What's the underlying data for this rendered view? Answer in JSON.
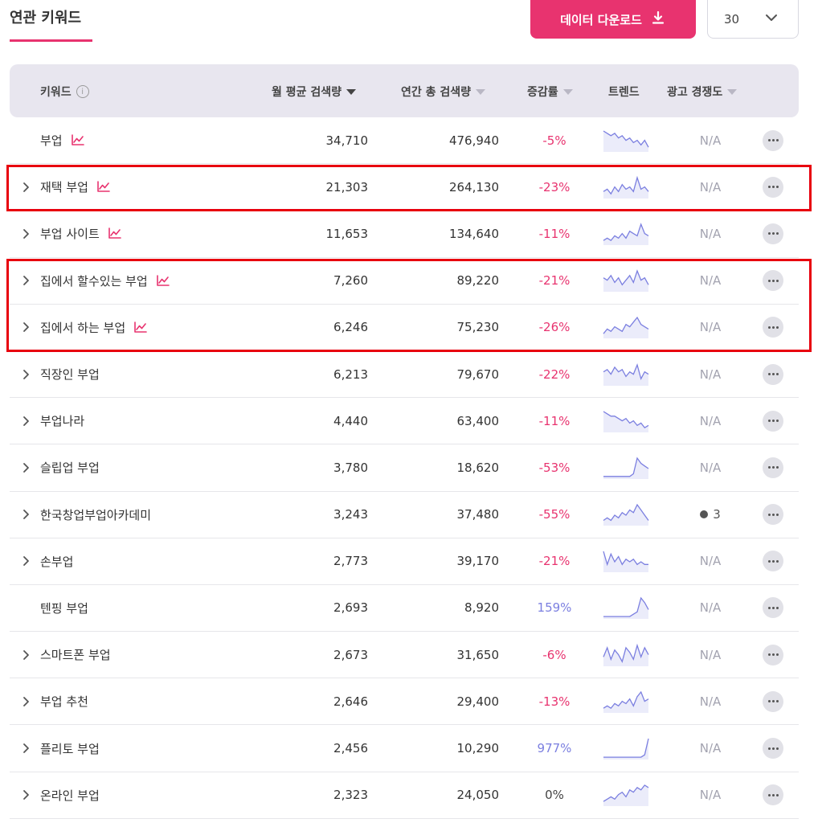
{
  "header": {
    "title": "연관 키워드",
    "download_label": "데이터 다운로드",
    "page_size": "30"
  },
  "columns": {
    "keyword": "키워드",
    "monthly": "월 평균 검색량",
    "yearly": "연간 총 검색량",
    "change": "증감률",
    "trend": "트렌드",
    "competition": "광고 경쟁도"
  },
  "colors": {
    "accent": "#e8336f",
    "negative": "#e8336f",
    "positive": "#7b7fe0",
    "neutral": "#444444",
    "highlight": "#e8000e",
    "sparkline": "#7b7fe0"
  },
  "rows": [
    {
      "keyword": "부업",
      "expandable": false,
      "trend_icon": true,
      "monthly": "34,710",
      "yearly": "476,940",
      "change": "-5%",
      "change_sign": "negative",
      "competition": "N/A",
      "spark": [
        9,
        8,
        7,
        8,
        6,
        7,
        5,
        6,
        4,
        5,
        3,
        5,
        2
      ]
    },
    {
      "keyword": "재택 부업",
      "expandable": true,
      "trend_icon": true,
      "monthly": "21,303",
      "yearly": "264,130",
      "change": "-23%",
      "change_sign": "negative",
      "competition": "N/A",
      "spark": [
        3,
        4,
        2,
        5,
        3,
        6,
        4,
        5,
        3,
        9,
        4,
        5,
        3
      ]
    },
    {
      "keyword": "부업 사이트",
      "expandable": true,
      "trend_icon": true,
      "monthly": "11,653",
      "yearly": "134,640",
      "change": "-11%",
      "change_sign": "negative",
      "competition": "N/A",
      "spark": [
        2,
        3,
        2,
        4,
        3,
        5,
        3,
        6,
        5,
        4,
        9,
        5,
        4
      ]
    },
    {
      "keyword": "집에서 할수있는 부업",
      "expandable": true,
      "trend_icon": true,
      "monthly": "7,260",
      "yearly": "89,220",
      "change": "-21%",
      "change_sign": "negative",
      "competition": "N/A",
      "spark": [
        6,
        5,
        7,
        4,
        6,
        3,
        5,
        7,
        4,
        9,
        5,
        6,
        3
      ]
    },
    {
      "keyword": "집에서 하는 부업",
      "expandable": true,
      "trend_icon": true,
      "monthly": "6,246",
      "yearly": "75,230",
      "change": "-26%",
      "change_sign": "negative",
      "competition": "N/A",
      "spark": [
        2,
        4,
        3,
        5,
        4,
        3,
        6,
        5,
        7,
        9,
        6,
        5,
        4
      ]
    },
    {
      "keyword": "직장인 부업",
      "expandable": true,
      "trend_icon": false,
      "monthly": "6,213",
      "yearly": "79,670",
      "change": "-22%",
      "change_sign": "negative",
      "competition": "N/A",
      "spark": [
        6,
        7,
        5,
        8,
        6,
        7,
        4,
        6,
        5,
        9,
        3,
        6,
        5
      ]
    },
    {
      "keyword": "부업나라",
      "expandable": true,
      "trend_icon": false,
      "monthly": "4,440",
      "yearly": "63,400",
      "change": "-11%",
      "change_sign": "negative",
      "competition": "N/A",
      "spark": [
        9,
        8,
        7,
        7,
        6,
        5,
        6,
        4,
        5,
        3,
        4,
        2,
        3
      ]
    },
    {
      "keyword": "슬립업 부업",
      "expandable": true,
      "trend_icon": false,
      "monthly": "3,780",
      "yearly": "18,620",
      "change": "-53%",
      "change_sign": "negative",
      "competition": "N/A",
      "spark": [
        1,
        1,
        1,
        1,
        1,
        1,
        1,
        1,
        2,
        8,
        6,
        5,
        4
      ]
    },
    {
      "keyword": "한국창업부업아카데미",
      "expandable": true,
      "trend_icon": false,
      "monthly": "3,243",
      "yearly": "37,480",
      "change": "-55%",
      "change_sign": "negative",
      "competition": "3",
      "competition_dot": true,
      "spark": [
        2,
        3,
        2,
        4,
        3,
        5,
        4,
        6,
        5,
        8,
        6,
        4,
        2
      ]
    },
    {
      "keyword": "손부업",
      "expandable": true,
      "trend_icon": false,
      "monthly": "2,773",
      "yearly": "39,170",
      "change": "-21%",
      "change_sign": "negative",
      "competition": "N/A",
      "spark": [
        8,
        3,
        7,
        4,
        6,
        3,
        5,
        4,
        5,
        3,
        4,
        3,
        3
      ]
    },
    {
      "keyword": "텐핑 부업",
      "expandable": false,
      "trend_icon": false,
      "monthly": "2,693",
      "yearly": "8,920",
      "change": "159%",
      "change_sign": "positive",
      "competition": "N/A",
      "spark": [
        1,
        1,
        1,
        1,
        1,
        1,
        1,
        1,
        2,
        3,
        9,
        7,
        4
      ]
    },
    {
      "keyword": "스마트폰 부업",
      "expandable": true,
      "trend_icon": false,
      "monthly": "2,673",
      "yearly": "31,650",
      "change": "-6%",
      "change_sign": "negative",
      "competition": "N/A",
      "spark": [
        4,
        8,
        3,
        7,
        5,
        2,
        8,
        6,
        3,
        9,
        4,
        8,
        5
      ]
    },
    {
      "keyword": "부업 추천",
      "expandable": true,
      "trend_icon": false,
      "monthly": "2,646",
      "yearly": "29,400",
      "change": "-13%",
      "change_sign": "negative",
      "competition": "N/A",
      "spark": [
        2,
        3,
        2,
        4,
        3,
        5,
        4,
        6,
        3,
        7,
        9,
        5,
        6
      ]
    },
    {
      "keyword": "플리토 부업",
      "expandable": true,
      "trend_icon": false,
      "monthly": "2,456",
      "yearly": "10,290",
      "change": "977%",
      "change_sign": "positive",
      "competition": "N/A",
      "spark": [
        1,
        1,
        1,
        1,
        1,
        1,
        1,
        1,
        1,
        1,
        1,
        2,
        9
      ]
    },
    {
      "keyword": "온라인 부업",
      "expandable": true,
      "trend_icon": false,
      "monthly": "2,323",
      "yearly": "24,050",
      "change": "0%",
      "change_sign": "neutral",
      "competition": "N/A",
      "spark": [
        2,
        3,
        4,
        3,
        5,
        6,
        4,
        7,
        6,
        8,
        7,
        9,
        8
      ]
    }
  ]
}
